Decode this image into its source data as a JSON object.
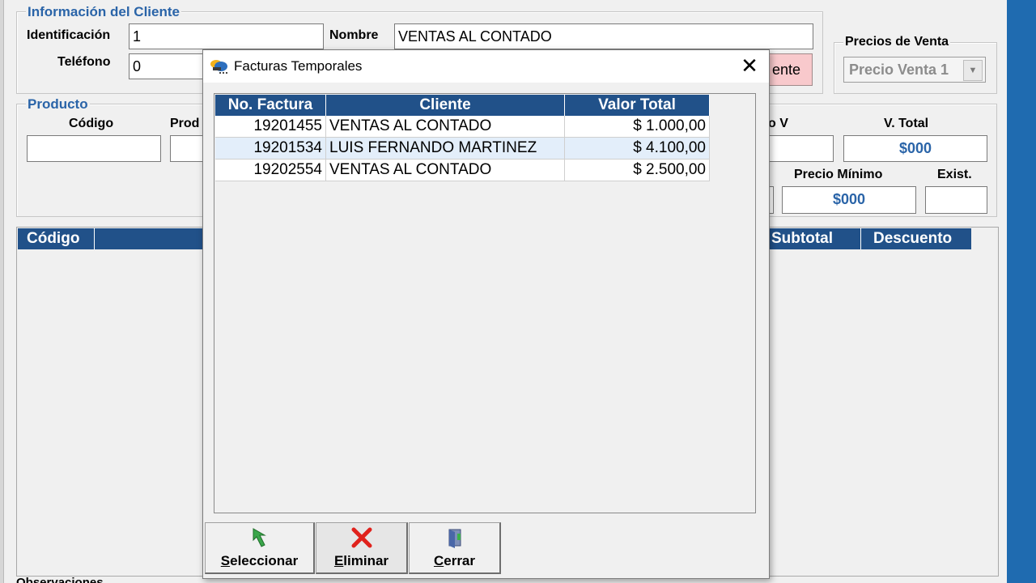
{
  "cliente": {
    "legend": "Información del Cliente",
    "identificacion_label": "Identificación",
    "identificacion_value": "1",
    "nombre_label": "Nombre",
    "nombre_value": "VENTAS AL CONTADO",
    "telefono_label": "Teléfono",
    "telefono_value": "0",
    "cliente_button_partial": "ente"
  },
  "precios": {
    "legend": "Precios de Venta",
    "selected": "Precio Venta 1"
  },
  "producto": {
    "legend": "Producto",
    "codigo_label": "Código",
    "producto_label_partial": "Prod",
    "pv_label_partial": "o V",
    "vtotal_label": "V. Total",
    "vtotal_value": "$000",
    "precio_minimo_label": "Precio Mínimo",
    "precio_minimo_value": "$000",
    "exist_label": "Exist."
  },
  "detalle": {
    "col_codigo": "Código",
    "col_subtotal": "Subtotal",
    "col_descuento": "Descuento"
  },
  "observaciones_label_partial": "Observaciones",
  "modal": {
    "title": "Facturas Temporales",
    "columns": [
      "No. Factura",
      "Cliente",
      "Valor Total"
    ],
    "rows": [
      {
        "factura": "19201455",
        "cliente": "VENTAS AL CONTADO",
        "valor": "$ 1.000,00"
      },
      {
        "factura": "19201534",
        "cliente": "LUIS FERNANDO MARTINEZ",
        "valor": "$ 4.100,00"
      },
      {
        "factura": "19202554",
        "cliente": "VENTAS AL CONTADO",
        "valor": "$ 2.500,00"
      }
    ],
    "buttons": {
      "seleccionar_first": "S",
      "seleccionar_rest": "eleccionar",
      "eliminar_first": "E",
      "eliminar_rest": "liminar",
      "cerrar_first": "C",
      "cerrar_rest": "errar"
    }
  },
  "colors": {
    "header_blue": "#215189",
    "accent_blue": "#2a64a8",
    "side_blue": "#1f6bb0",
    "selected_row": "#e3eefa"
  }
}
